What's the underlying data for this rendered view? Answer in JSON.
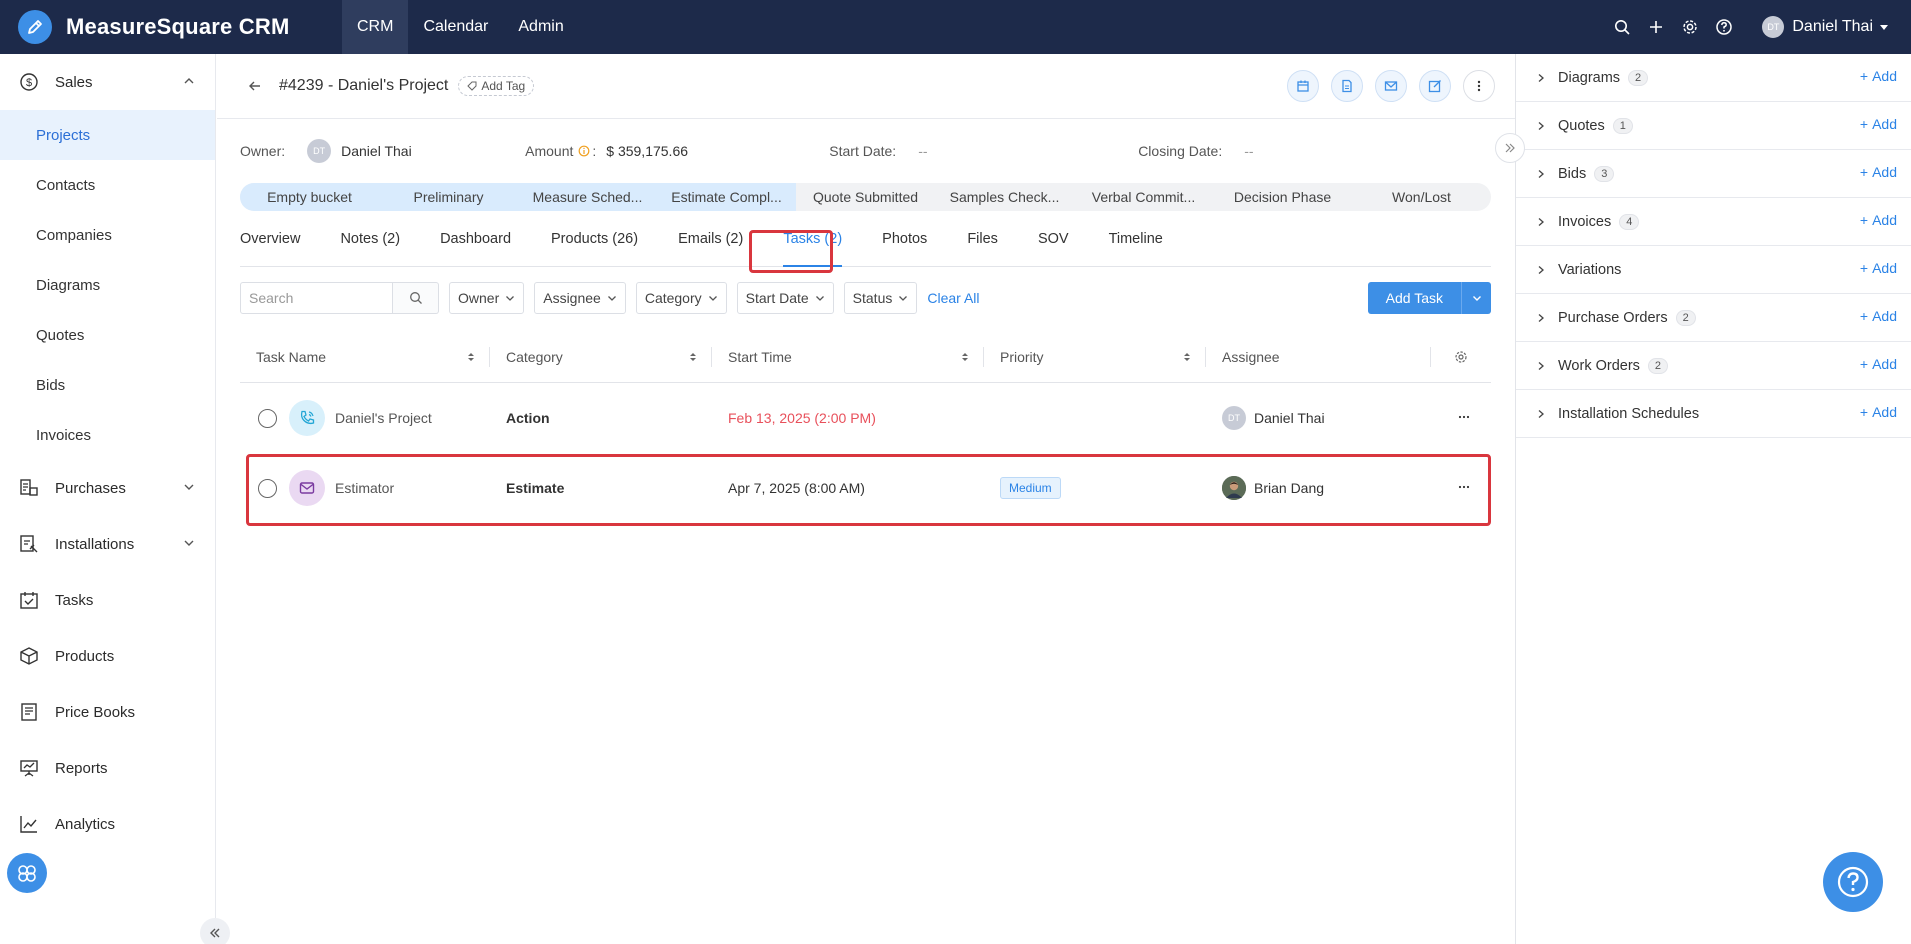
{
  "app": {
    "name": "MeasureSquare CRM"
  },
  "topnav": [
    {
      "label": "CRM"
    },
    {
      "label": "Calendar"
    },
    {
      "label": "Admin"
    }
  ],
  "user": {
    "initials": "DT",
    "name": "Daniel Thai"
  },
  "sidebar": {
    "sales": "Sales",
    "sales_items": [
      {
        "label": "Projects"
      },
      {
        "label": "Contacts"
      },
      {
        "label": "Companies"
      },
      {
        "label": "Diagrams"
      },
      {
        "label": "Quotes"
      },
      {
        "label": "Bids"
      },
      {
        "label": "Invoices"
      }
    ],
    "groups": [
      {
        "label": "Purchases"
      },
      {
        "label": "Installations"
      },
      {
        "label": "Tasks"
      },
      {
        "label": "Products"
      },
      {
        "label": "Price Books"
      },
      {
        "label": "Reports"
      },
      {
        "label": "Analytics"
      }
    ]
  },
  "project": {
    "title": "#4239 - Daniel's Project",
    "add_tag": "Add Tag",
    "owner_label": "Owner:",
    "owner_initials": "DT",
    "owner_name": "Daniel Thai",
    "amount_label": "Amount",
    "amount_colon": ":",
    "amount_value": "$ 359,175.66",
    "start_label": "Start Date:",
    "start_value": "--",
    "closing_label": "Closing Date:",
    "closing_value": "--"
  },
  "stages": [
    {
      "label": "Empty bucket"
    },
    {
      "label": "Preliminary"
    },
    {
      "label": "Measure Sched..."
    },
    {
      "label": "Estimate Compl..."
    },
    {
      "label": "Quote Submitted"
    },
    {
      "label": "Samples Check..."
    },
    {
      "label": "Verbal Commit..."
    },
    {
      "label": "Decision Phase"
    },
    {
      "label": "Won/Lost"
    }
  ],
  "tabs": [
    {
      "label": "Overview"
    },
    {
      "label": "Notes (2)"
    },
    {
      "label": "Dashboard"
    },
    {
      "label": "Products (26)"
    },
    {
      "label": "Emails (2)"
    },
    {
      "label": "Tasks (2)"
    },
    {
      "label": "Photos"
    },
    {
      "label": "Files"
    },
    {
      "label": "SOV"
    },
    {
      "label": "Timeline"
    }
  ],
  "filters": {
    "search_placeholder": "Search",
    "owner": "Owner",
    "assignee": "Assignee",
    "category": "Category",
    "start_date": "Start Date",
    "status": "Status",
    "clear_all": "Clear All",
    "add_task": "Add Task"
  },
  "table": {
    "headers": [
      "Task Name",
      "Category",
      "Start Time",
      "Priority",
      "Assignee"
    ],
    "rows": [
      {
        "name": "Daniel's Project",
        "category": "Action",
        "start": "Feb 13, 2025 (2:00 PM)",
        "priority": "",
        "assignee_initials": "DT",
        "assignee": "Daniel Thai",
        "icon": "phone-icon",
        "start_color": "#e8505b"
      },
      {
        "name": "Estimator",
        "category": "Estimate",
        "start": "Apr 7, 2025 (8:00 AM)",
        "priority": "Medium",
        "assignee_initials": "",
        "assignee": "Brian Dang",
        "icon": "mail-icon",
        "start_color": "#333333"
      }
    ]
  },
  "right_panel": {
    "add_label": "Add",
    "items": [
      {
        "label": "Diagrams",
        "count": "2"
      },
      {
        "label": "Quotes",
        "count": "1"
      },
      {
        "label": "Bids",
        "count": "3"
      },
      {
        "label": "Invoices",
        "count": "4"
      },
      {
        "label": "Variations",
        "count": ""
      },
      {
        "label": "Purchase Orders",
        "count": "2"
      },
      {
        "label": "Work Orders",
        "count": "2"
      },
      {
        "label": "Installation Schedules",
        "count": ""
      }
    ]
  },
  "colors": {
    "accent": "#3d8fe6",
    "topbar": "#1d2a4a",
    "highlight": "#d9363e",
    "overdue": "#e8505b"
  }
}
